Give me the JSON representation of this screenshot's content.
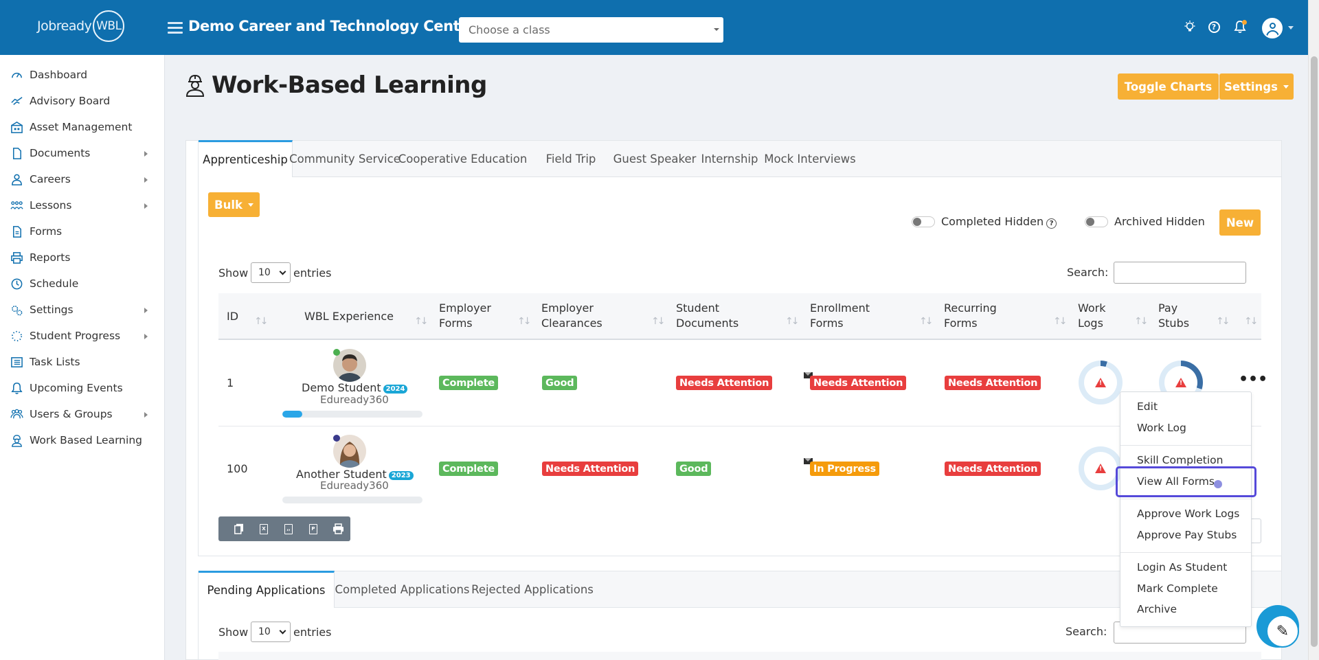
{
  "app": {
    "logo_text": "Jobready",
    "logo_badge": "WBL",
    "org_title": "Demo Career and Technology Center",
    "class_select_placeholder": "Choose a class"
  },
  "sidebar": {
    "items": [
      {
        "label": "Dashboard",
        "icon": "dashboard-icon",
        "has_submenu": false
      },
      {
        "label": "Advisory Board",
        "icon": "handshake-icon",
        "has_submenu": false
      },
      {
        "label": "Asset Management",
        "icon": "warehouse-icon",
        "has_submenu": false
      },
      {
        "label": "Documents",
        "icon": "document-icon",
        "has_submenu": true
      },
      {
        "label": "Careers",
        "icon": "careers-icon",
        "has_submenu": true
      },
      {
        "label": "Lessons",
        "icon": "lessons-icon",
        "has_submenu": true
      },
      {
        "label": "Forms",
        "icon": "form-icon",
        "has_submenu": false
      },
      {
        "label": "Reports",
        "icon": "printer-icon",
        "has_submenu": false
      },
      {
        "label": "Schedule",
        "icon": "clock-icon",
        "has_submenu": false
      },
      {
        "label": "Settings",
        "icon": "gears-icon",
        "has_submenu": true
      },
      {
        "label": "Student Progress",
        "icon": "spinner-icon",
        "has_submenu": true
      },
      {
        "label": "Task Lists",
        "icon": "list-icon",
        "has_submenu": false
      },
      {
        "label": "Upcoming Events",
        "icon": "bell-icon",
        "has_submenu": false
      },
      {
        "label": "Users & Groups",
        "icon": "users-icon",
        "has_submenu": true
      },
      {
        "label": "Work Based Learning",
        "icon": "worker-icon",
        "has_submenu": false
      }
    ]
  },
  "page": {
    "title": "Work-Based Learning",
    "toggle_charts_label": "Toggle Charts",
    "settings_label": "Settings"
  },
  "tabs_top": [
    "Apprenticeship",
    "Community Service",
    "Cooperative Education",
    "Field Trip",
    "Guest Speaker",
    "Internship",
    "Mock Interviews"
  ],
  "toolbar": {
    "bulk_label": "Bulk",
    "completed_hidden_label": "Completed Hidden",
    "archived_hidden_label": "Archived Hidden",
    "new_label": "New"
  },
  "table": {
    "show_label": "Show",
    "entries_value": "10",
    "entries_label": "entries",
    "search_label": "Search:",
    "columns": {
      "id": "ID",
      "wbl_experience": "WBL Experience",
      "employer_forms": [
        "Employer",
        "Forms"
      ],
      "employer_clearances": [
        "Employer",
        "Clearances"
      ],
      "student_documents": [
        "Student",
        "Documents"
      ],
      "enrollment_forms": [
        "Enrollment",
        "Forms"
      ],
      "recurring_forms": [
        "Recurring",
        "Forms"
      ],
      "work_logs": [
        "Work",
        "Logs"
      ],
      "pay_stubs": [
        "Pay",
        "Stubs"
      ]
    },
    "rows": [
      {
        "id": "1",
        "name": "Demo Student",
        "year": "2024",
        "org": "Eduready360",
        "progress": 0.14,
        "status_color": "#4caf50",
        "employer_forms": "Complete",
        "employer_clearances": "Good",
        "student_documents": "Needs Attention",
        "enrollment_forms": "Needs Attention",
        "recurring_forms": "Needs Attention",
        "work_logs_fill": 0.05,
        "pay_stubs_fill": 0.3
      },
      {
        "id": "100",
        "name": "Another Student",
        "year": "2023",
        "org": "Eduready360",
        "progress": 0.0,
        "status_color": "#3a3a8c",
        "employer_forms": "Complete",
        "employer_clearances": "Needs Attention",
        "student_documents": "Good",
        "enrollment_forms": "In Progress",
        "recurring_forms": "Needs Attention",
        "work_logs_fill": 0.0,
        "pay_stubs_fill": 0.0
      }
    ]
  },
  "tabs_bottom": [
    "Pending Applications",
    "Completed Applications",
    "Rejected Applications"
  ],
  "table2": {
    "show_label": "Show",
    "entries_value": "10",
    "entries_label": "entries",
    "search_label": "Search:"
  },
  "row_menu": {
    "items": [
      "Edit",
      "Work Log",
      "Skill Completion",
      "View All Forms",
      "Approve Work Logs",
      "Approve Pay Stubs",
      "Login As Student",
      "Mark Complete",
      "Archive"
    ],
    "highlighted": "View All Forms"
  },
  "colors": {
    "topbar": "#0f6fae",
    "accent_orange": "#f7b035",
    "badge_green": "#5cb85c",
    "badge_red": "#e83e3e",
    "badge_orange": "#f59b0b",
    "highlight": "#5549d9"
  }
}
